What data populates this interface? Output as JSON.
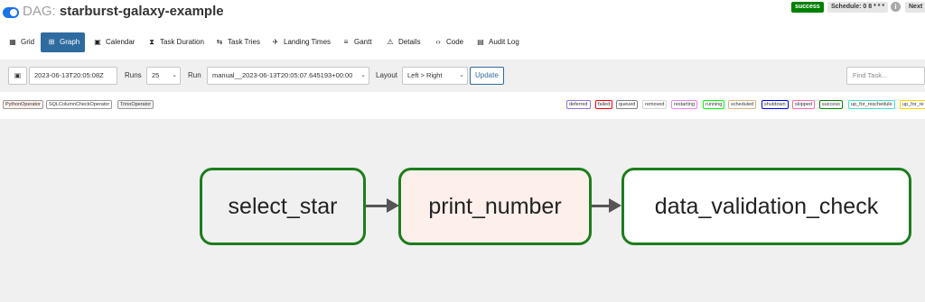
{
  "header": {
    "dag_prefix": "DAG:",
    "dag_name": "starburst-galaxy-example",
    "status_badge": "success",
    "schedule_badge": "Schedule: 0 8 * * *",
    "next_badge": "Next",
    "info_icon": "info-icon"
  },
  "tabs": [
    {
      "label": "Grid",
      "icon": "grid-icon",
      "glyph": "▦"
    },
    {
      "label": "Graph",
      "icon": "graph-icon",
      "glyph": "⊞"
    },
    {
      "label": "Calendar",
      "icon": "calendar-icon",
      "glyph": "▣"
    },
    {
      "label": "Task Duration",
      "icon": "hourglass-icon",
      "glyph": "⧗"
    },
    {
      "label": "Task Tries",
      "icon": "retry-icon",
      "glyph": "⇆"
    },
    {
      "label": "Landing Times",
      "icon": "landing-icon",
      "glyph": "✈"
    },
    {
      "label": "Gantt",
      "icon": "gantt-icon",
      "glyph": "≡"
    },
    {
      "label": "Details",
      "icon": "warning-icon",
      "glyph": "⚠"
    },
    {
      "label": "Code",
      "icon": "code-icon",
      "glyph": "‹›"
    },
    {
      "label": "Audit Log",
      "icon": "audit-icon",
      "glyph": "▤"
    }
  ],
  "toolbar": {
    "date_value": "2023-06-13T20:05:08Z",
    "runs_label": "Runs",
    "runs_value": "25",
    "run_label": "Run",
    "run_value": "manual__2023-06-13T20:05:07.645193+00:00",
    "layout_label": "Layout",
    "layout_value": "Left > Right",
    "update_label": "Update",
    "find_placeholder": "Find Task..."
  },
  "operators": [
    "PythonOperator",
    "SQLColumnCheckOperator",
    "TrinoOperator"
  ],
  "states": [
    {
      "label": "deferred",
      "color": "#9370db"
    },
    {
      "label": "failed",
      "color": "#ff0000"
    },
    {
      "label": "queued",
      "color": "#808080"
    },
    {
      "label": "removed",
      "color": "#d3d3d3"
    },
    {
      "label": "restarting",
      "color": "#ee82ee"
    },
    {
      "label": "running",
      "color": "#00ff00"
    },
    {
      "label": "scheduled",
      "color": "#d2b48c"
    },
    {
      "label": "shutdown",
      "color": "#0000ff"
    },
    {
      "label": "skipped",
      "color": "#ff69b4"
    },
    {
      "label": "success",
      "color": "#008000"
    },
    {
      "label": "up_for_reschedule",
      "color": "#40e0d0"
    },
    {
      "label": "up_for_re",
      "color": "#ffd700"
    }
  ],
  "graph": {
    "nodes": [
      {
        "label": "select_star",
        "fill": "#f0f0f0"
      },
      {
        "label": "print_number",
        "fill": "#fdefe9"
      },
      {
        "label": "data_validation_check",
        "fill": "#ffffff"
      }
    ],
    "node_border_color": "#1d7d1d"
  }
}
